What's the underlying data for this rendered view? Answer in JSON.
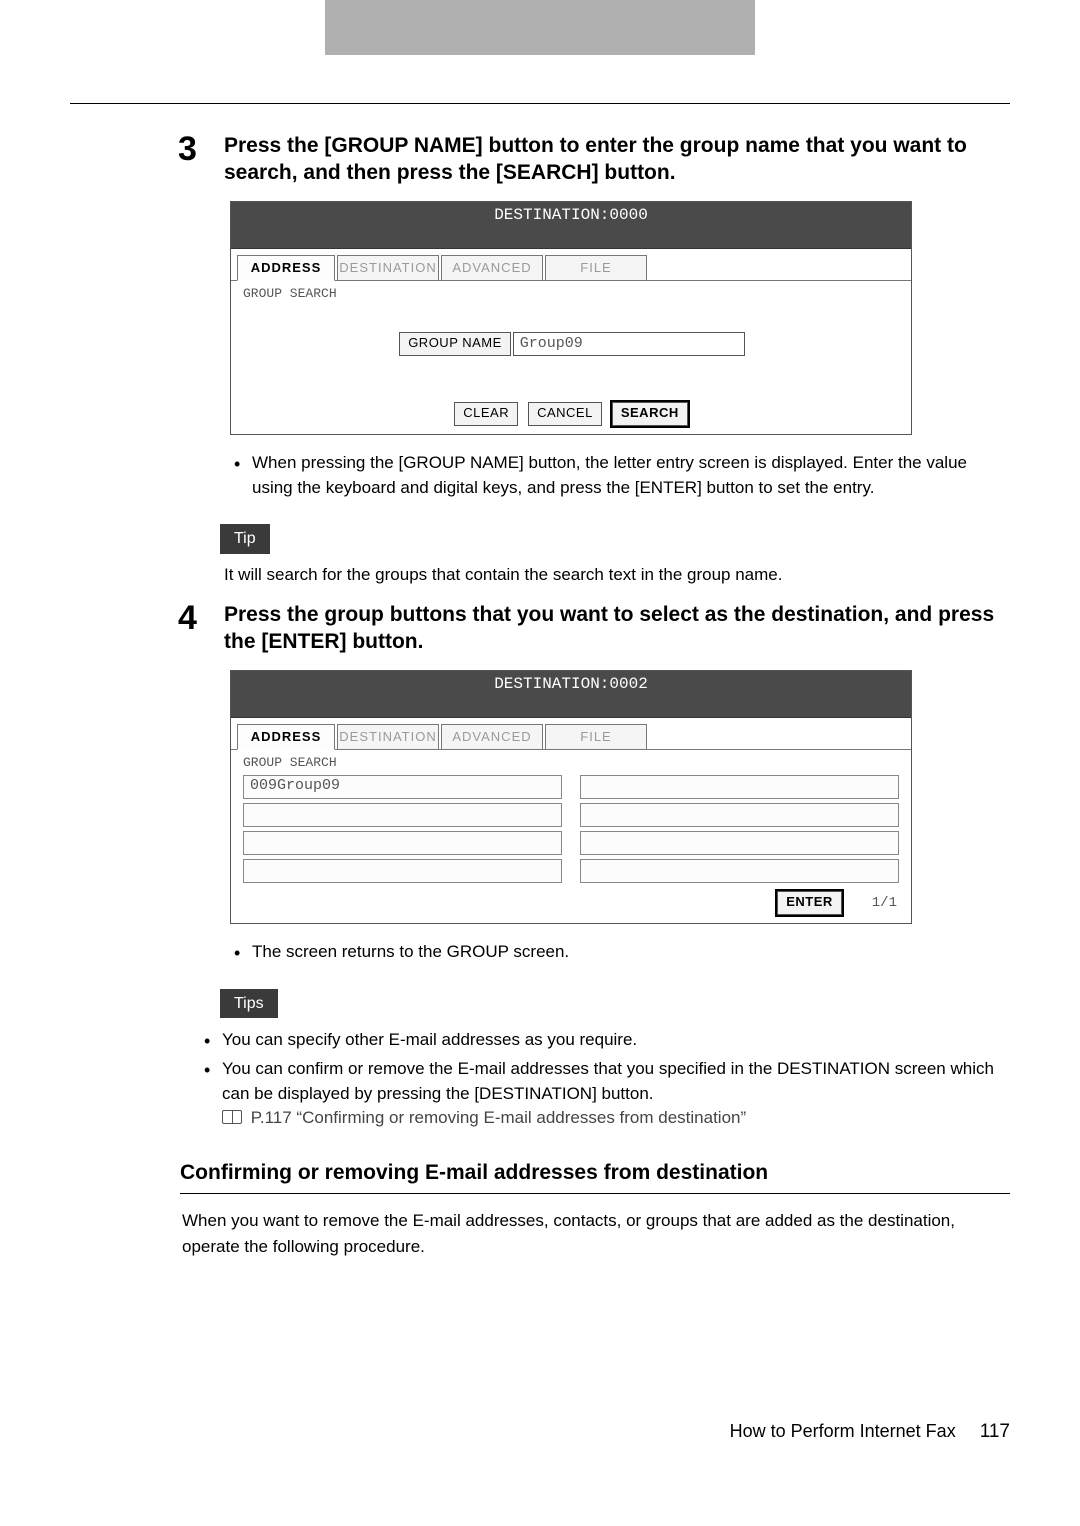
{
  "step3": {
    "num": "3",
    "heading": "Press the [GROUP NAME] button to enter the group name that you want to search, and then press the [SEARCH] button.",
    "screen": {
      "title": "DESTINATION:0000",
      "tabs": {
        "address": "ADDRESS",
        "destination": "DESTINATION",
        "advanced": "ADVANCED",
        "file": "FILE"
      },
      "subtitle": "GROUP SEARCH",
      "groupname_btn": "GROUP NAME",
      "groupname_value": "Group09",
      "clear": "CLEAR",
      "cancel": "CANCEL",
      "search": "SEARCH"
    },
    "bullet": "When pressing the [GROUP NAME] button, the letter entry screen is displayed. Enter the value using the keyboard and digital keys, and press the [ENTER] button to set the entry."
  },
  "tip1": {
    "label": "Tip",
    "text": "It will search for the groups that contain the search text in the group name."
  },
  "step4": {
    "num": "4",
    "heading": "Press the group buttons that you want to select as the destination, and press the [ENTER] button.",
    "screen": {
      "title": "DESTINATION:0002",
      "tabs": {
        "address": "ADDRESS",
        "destination": "DESTINATION",
        "advanced": "ADVANCED",
        "file": "FILE"
      },
      "subtitle": "GROUP SEARCH",
      "result0": "009Group09",
      "enter": "ENTER",
      "pager": "1/1"
    },
    "bullet": "The screen returns to the GROUP screen."
  },
  "tips2": {
    "label": "Tips",
    "b1": "You can specify other E-mail addresses as you require.",
    "b2": "You can confirm or remove the E-mail addresses that you specified in the DESTINATION screen which can be displayed by pressing the [DESTINATION] button.",
    "link": "P.117 “Confirming or removing E-mail addresses from destination”"
  },
  "section": {
    "title": "Confirming or removing E-mail addresses from destination",
    "para": "When you want to remove the E-mail addresses, contacts, or groups that are added as the destination, operate the following procedure."
  },
  "footer": {
    "label": "How to Perform Internet Fax",
    "page": "117"
  }
}
